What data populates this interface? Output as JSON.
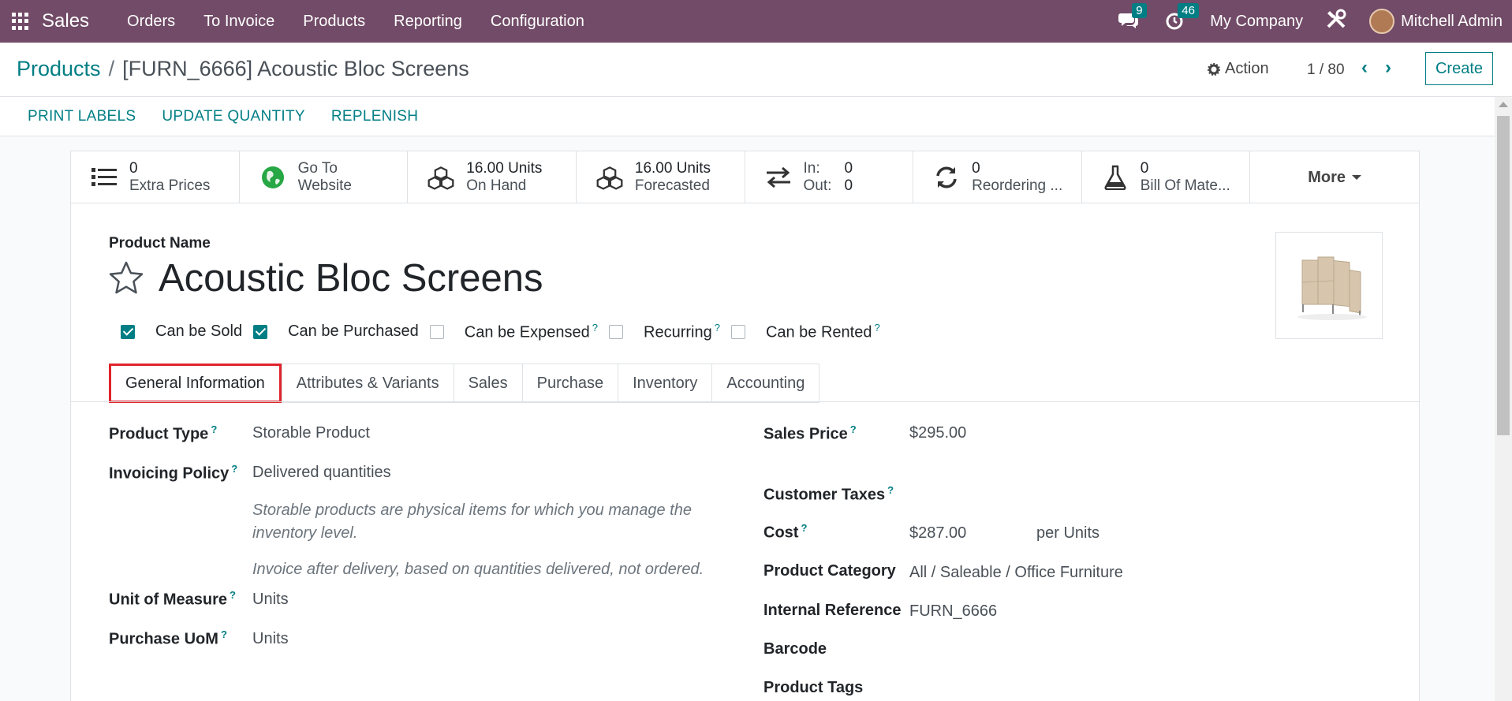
{
  "topbar": {
    "app_name": "Sales",
    "menu": [
      "Orders",
      "To Invoice",
      "Products",
      "Reporting",
      "Configuration"
    ],
    "messages_count": "9",
    "activities_count": "46",
    "company": "My Company",
    "user": "Mitchell Admin",
    "accent_color": "#714b67"
  },
  "control": {
    "breadcrumb_parent": "Products",
    "breadcrumb_sep": "/",
    "breadcrumb_current": "[FURN_6666] Acoustic Bloc Screens",
    "action_label": "Action",
    "pager": "1 / 80",
    "create_label": "Create"
  },
  "header_buttons": [
    "PRINT LABELS",
    "UPDATE QUANTITY",
    "REPLENISH"
  ],
  "smart_buttons": [
    {
      "icon": "list-icon",
      "value": "0",
      "label": "Extra Prices"
    },
    {
      "icon": "globe-icon",
      "value": "Go To",
      "label": "Website"
    },
    {
      "icon": "cubes-icon",
      "value": "16.00 Units",
      "label": "On Hand"
    },
    {
      "icon": "cubes-icon",
      "value": "16.00 Units",
      "label": "Forecasted"
    },
    {
      "icon": "exchange-icon",
      "in_label": "In:",
      "in_value": "0",
      "out_label": "Out:",
      "out_value": "0"
    },
    {
      "icon": "refresh-icon",
      "value": "0",
      "label": "Reordering ..."
    },
    {
      "icon": "flask-icon",
      "value": "0",
      "label": "Bill Of Mate..."
    },
    {
      "label": "More"
    }
  ],
  "product": {
    "name_label": "Product Name",
    "name": "Acoustic Bloc Screens",
    "checks": [
      {
        "label": "Can be Sold",
        "checked": true,
        "help": ""
      },
      {
        "label": "Can be Purchased",
        "checked": true,
        "help": ""
      },
      {
        "label": "Can be Expensed",
        "checked": false,
        "help": "?"
      },
      {
        "label": "Recurring",
        "checked": false,
        "help": "?"
      },
      {
        "label": "Can be Rented",
        "checked": false,
        "help": "?"
      }
    ]
  },
  "tabs": [
    "General Information",
    "Attributes & Variants",
    "Sales",
    "Purchase",
    "Inventory",
    "Accounting"
  ],
  "active_tab": "General Information",
  "general": {
    "product_type_label": "Product Type",
    "product_type": "Storable Product",
    "invoicing_policy_label": "Invoicing Policy",
    "invoicing_policy": "Delivered quantities",
    "note1": "Storable products are physical items for which you manage the inventory level.",
    "note2": "Invoice after delivery, based on quantities delivered, not ordered.",
    "uom_label": "Unit of Measure",
    "uom": "Units",
    "purchase_uom_label": "Purchase UoM",
    "purchase_uom": "Units",
    "sales_price_label": "Sales Price",
    "sales_price": "$295.00",
    "customer_taxes_label": "Customer Taxes",
    "cost_label": "Cost",
    "cost": "$287.00",
    "cost_unit": "per Units",
    "category_label": "Product Category",
    "category": "All / Saleable / Office Furniture",
    "internal_ref_label": "Internal Reference",
    "internal_ref": "FURN_6666",
    "barcode_label": "Barcode",
    "tags_label": "Product Tags",
    "help_mark": "?"
  }
}
